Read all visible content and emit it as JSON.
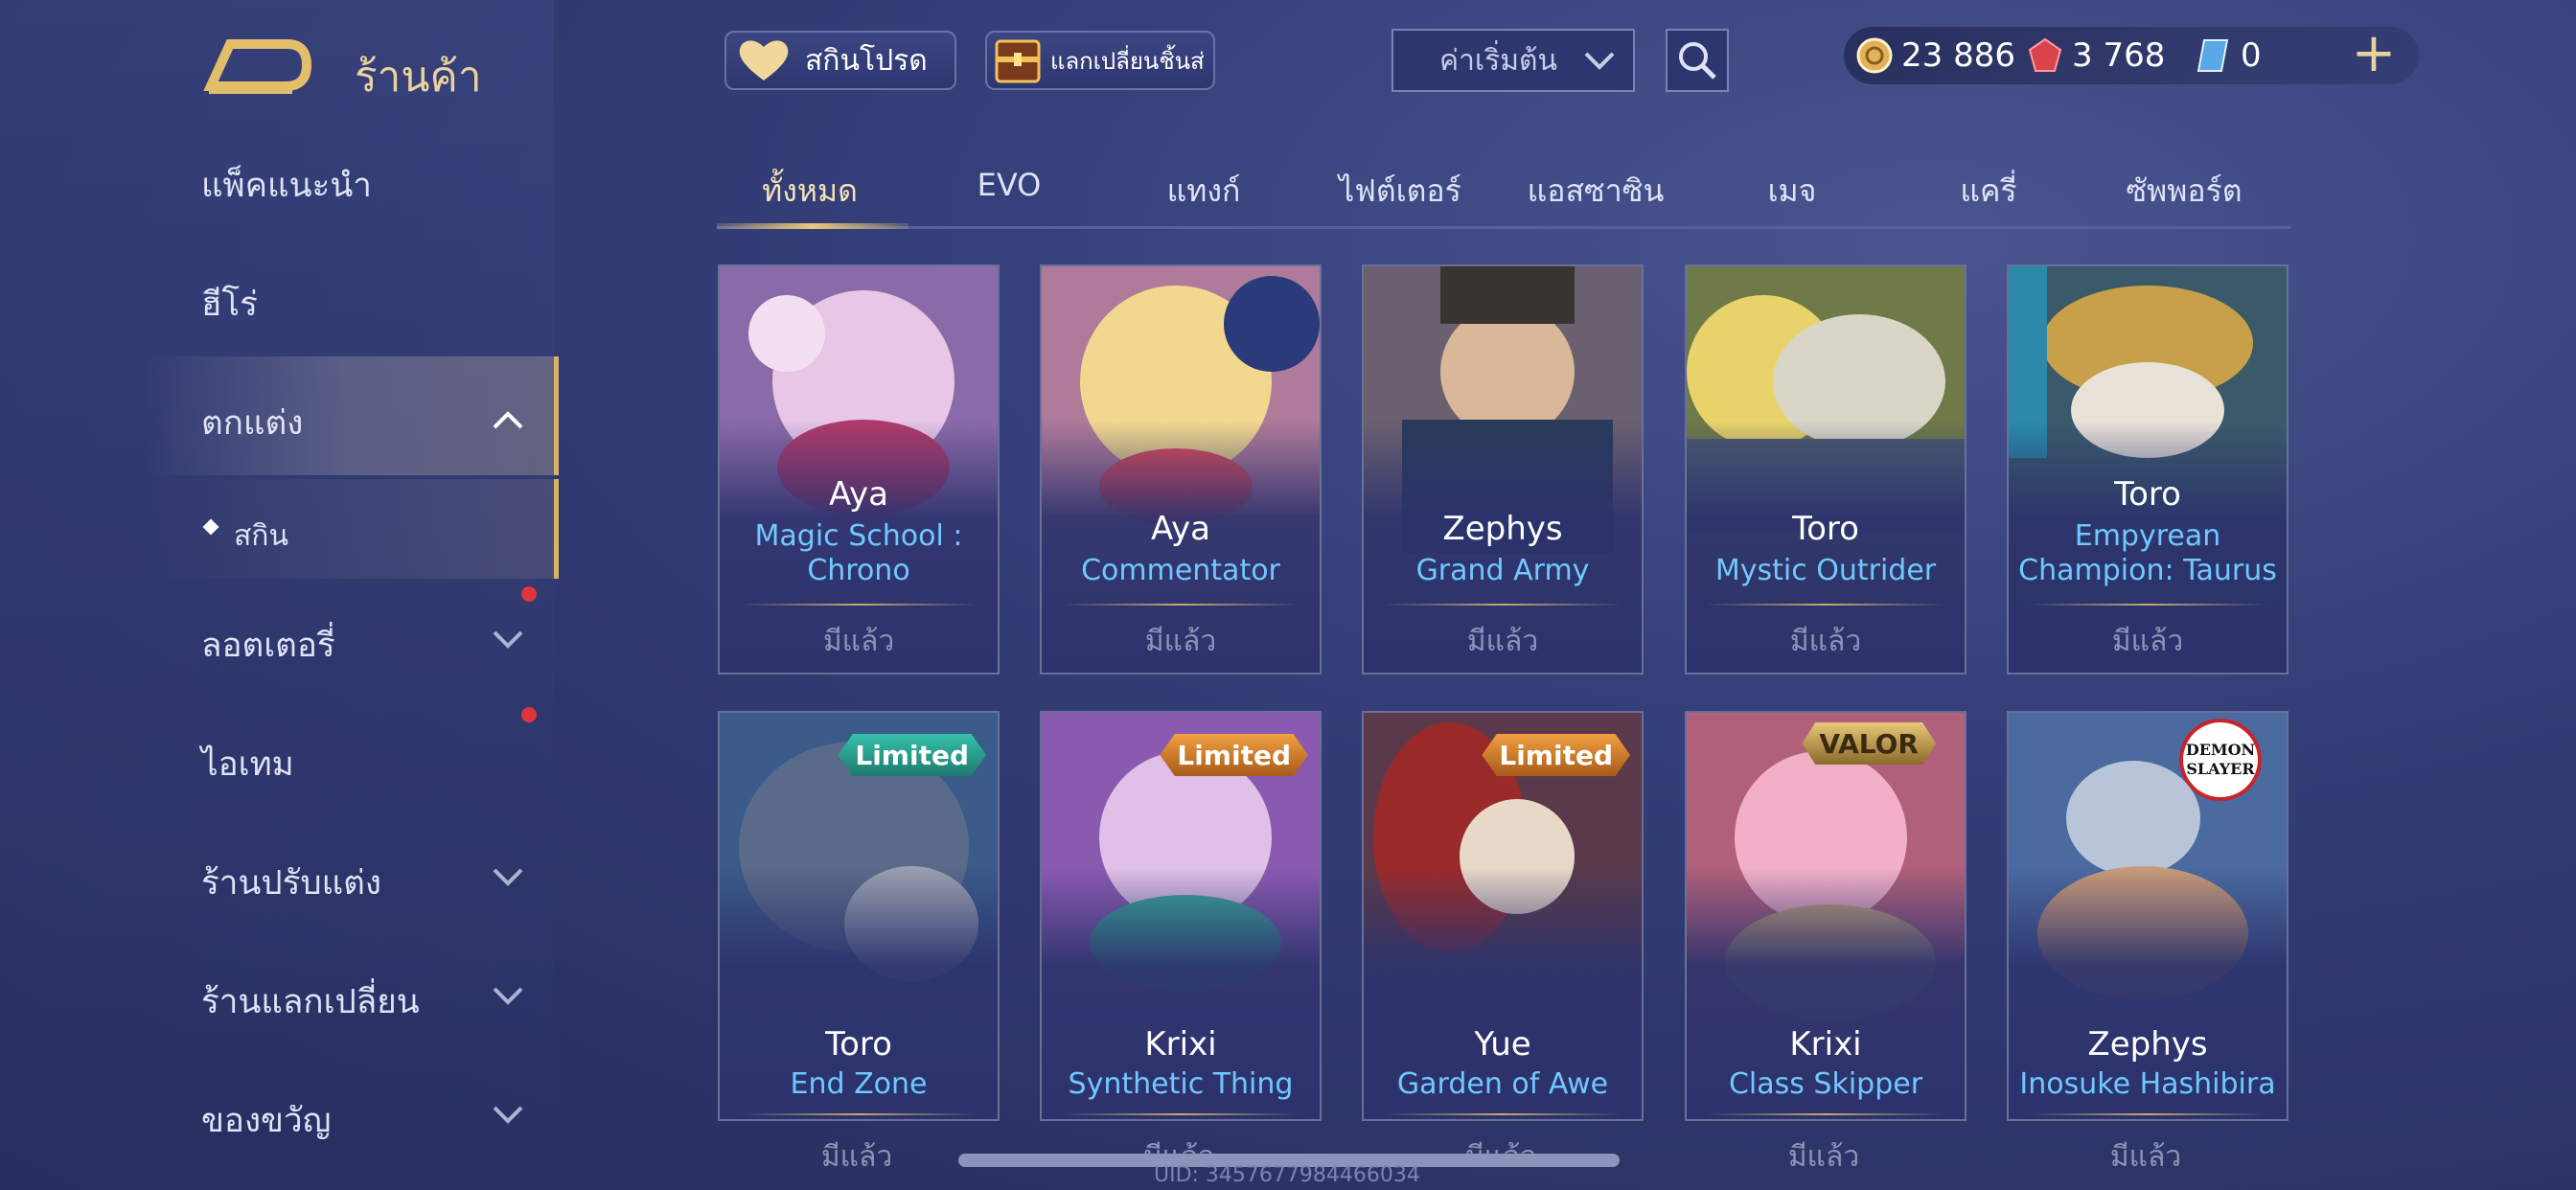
{
  "header": {
    "title": "ร้านค้า"
  },
  "sidebar": {
    "items": [
      {
        "label": "แพ็คแนะนำ"
      },
      {
        "label": "ฮีโร่"
      },
      {
        "label": "ตกแต่ง"
      },
      {
        "label": "สกิน"
      },
      {
        "label": "ลอตเตอรี่"
      },
      {
        "label": "ไอเทม"
      },
      {
        "label": "ร้านปรับแต่ง"
      },
      {
        "label": "ร้านแลกเปลี่ยน"
      },
      {
        "label": "ของขวัญ"
      }
    ]
  },
  "topbar": {
    "fav_label": "สกินโปรด",
    "exchange_label": "แลกเปลี่ยนชิ้นส่",
    "sort_value": "ค่าเริ่มต้น",
    "gold": "23 886",
    "vouchers": "3 768",
    "tokens": "0"
  },
  "tabs": [
    {
      "label": "ทั้งหมด"
    },
    {
      "label": "EVO"
    },
    {
      "label": "แทงก์"
    },
    {
      "label": "ไฟต์เตอร์"
    },
    {
      "label": "แอสซาซิน"
    },
    {
      "label": "เมจ"
    },
    {
      "label": "แครี่"
    },
    {
      "label": "ซัพพอร์ต"
    }
  ],
  "cards": [
    {
      "hero": "Aya",
      "skin": "Magic School : Chrono",
      "skin1": "Magic School :",
      "skin2": "Chrono",
      "owned": "มีแล้ว",
      "badge": ""
    },
    {
      "hero": "Aya",
      "skin": "Commentator",
      "skin1": "Commentator",
      "skin2": "",
      "owned": "มีแล้ว",
      "badge": ""
    },
    {
      "hero": "Zephys",
      "skin": "Grand Army",
      "skin1": "Grand Army",
      "skin2": "",
      "owned": "มีแล้ว",
      "badge": ""
    },
    {
      "hero": "Toro",
      "skin": "Mystic Outrider",
      "skin1": "Mystic Outrider",
      "skin2": "",
      "owned": "มีแล้ว",
      "badge": ""
    },
    {
      "hero": "Toro",
      "skin": "Empyrean Champion: Taurus",
      "skin1": "Empyrean",
      "skin2": "Champion: Taurus",
      "owned": "มีแล้ว",
      "badge": ""
    },
    {
      "hero": "Toro",
      "skin": "End Zone",
      "skin1": "End Zone",
      "skin2": "",
      "owned": "มีแล้ว",
      "badge": "Limited"
    },
    {
      "hero": "Krixi",
      "skin": "Synthetic Thing",
      "skin1": "Synthetic Thing",
      "skin2": "",
      "owned": "มีแล้ว",
      "badge": "Limited"
    },
    {
      "hero": "Yue",
      "skin": "Garden of Awe",
      "skin1": "Garden of Awe",
      "skin2": "",
      "owned": "มีแล้ว",
      "badge": "Limited"
    },
    {
      "hero": "Krixi",
      "skin": "Class Skipper",
      "skin1": "Class Skipper",
      "skin2": "",
      "owned": "มีแล้ว",
      "badge": "VALOR"
    },
    {
      "hero": "Zephys",
      "skin": "Inosuke Hashibira",
      "skin1": "Inosuke Hashibira",
      "skin2": "",
      "owned": "มีแล้ว",
      "badge": "DEMON SLAYER"
    }
  ],
  "footer": {
    "uid": "UID: 3457677984466034"
  },
  "colors": {
    "accent_gold": "#d8b46a",
    "skin_blue": "#6fc8ff",
    "limited_teal": "#2fa89a",
    "limited_orange": "#d9822b"
  }
}
